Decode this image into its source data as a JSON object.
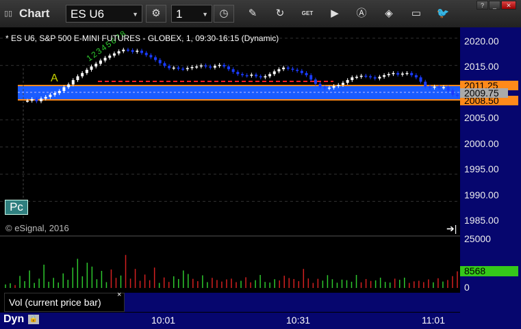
{
  "window": {
    "title": "Chart",
    "symbol": "ES U6",
    "interval": "1",
    "buttons": [
      "minimize",
      "maximize",
      "close"
    ]
  },
  "toolbar": {
    "icons": [
      "gear-icon",
      "clock-icon",
      "pencil-icon",
      "refresh-icon",
      "get-icon",
      "play-icon",
      "alert-icon",
      "tag-icon",
      "chat-icon",
      "twitter-icon"
    ],
    "get_label": "GET"
  },
  "chart": {
    "title": "* ES U6, S&P 500 E-MINI FUTURES - GLOBEX, 1, 09:30-16:15 (Dynamic)",
    "copyright": "© eSignal, 2016",
    "y_ticks": [
      "2020.00",
      "2015.00",
      "2010.00",
      "2005.00",
      "2000.00",
      "1995.00",
      "1990.00",
      "1985.00"
    ],
    "price_upper": "2011.25",
    "price_last": "2009.75",
    "price_lower": "2008.50",
    "marker_a": "A",
    "marker_pc": "Pc",
    "wave_labels": [
      "1",
      "2",
      "3",
      "4",
      "5",
      "6",
      "7",
      "8"
    ],
    "colors": {
      "up": "#ffffff",
      "down": "#1a3cff",
      "band": "#1a5cff",
      "upper_line": "#ff8a1a",
      "red_dash": "#ff2020",
      "accent_green": "#2ec92e",
      "axis_bg": "#06066e"
    }
  },
  "volume": {
    "label": "Vol (current price bar)",
    "close": "×",
    "y_ticks": [
      "25000",
      "0"
    ],
    "current": "8568",
    "colors": {
      "up": "#2ec92e",
      "down": "#d42020"
    }
  },
  "time_axis": {
    "labels": [
      "10:01",
      "10:31",
      "11:01"
    ],
    "mode": "Dyn"
  },
  "chart_data": {
    "type": "candlestick",
    "y_ylim": [
      1984,
      2022
    ],
    "prices": [
      2008.5,
      2008.8,
      2008.4,
      2008.9,
      2009.2,
      2009.6,
      2009.9,
      2010.3,
      2011.0,
      2011.5,
      2012.3,
      2013.0,
      2013.6,
      2014.2,
      2014.8,
      2015.3,
      2015.9,
      2016.4,
      2016.8,
      2017.2,
      2017.6,
      2017.9,
      2017.8,
      2017.5,
      2017.7,
      2017.3,
      2016.9,
      2016.5,
      2016.0,
      2015.4,
      2014.9,
      2014.5,
      2014.6,
      2014.4,
      2014.3,
      2014.5,
      2014.7,
      2014.8,
      2015.0,
      2014.8,
      2014.6,
      2014.9,
      2015.1,
      2014.8,
      2014.3,
      2013.8,
      2013.4,
      2013.2,
      2013.1,
      2013.3,
      2013.0,
      2012.8,
      2013.0,
      2013.4,
      2013.9,
      2014.3,
      2014.6,
      2014.4,
      2014.2,
      2014.0,
      2013.6,
      2013.2,
      2012.4,
      2011.6,
      2011.0,
      2010.8,
      2010.9,
      2011.2,
      2011.4,
      2011.8,
      2012.3,
      2012.8,
      2012.9,
      2013.1,
      2013.0,
      2012.8,
      2012.6,
      2012.9,
      2013.2,
      2013.4,
      2013.6,
      2013.3,
      2013.5,
      2013.6,
      2013.2,
      2012.8,
      2012.0,
      2011.1,
      2010.9,
      2011.1,
      2010.9,
      2011.0,
      2010.4,
      2009.6,
      2009.4
    ],
    "volumes": [
      1800,
      2400,
      1500,
      6200,
      3500,
      9000,
      2600,
      4800,
      12000,
      3200,
      5200,
      2800,
      7500,
      4200,
      10500,
      15000,
      6000,
      13000,
      11000,
      4500,
      8800,
      3000,
      9500,
      5200,
      6400,
      17000,
      4800,
      9800,
      3700,
      6900,
      4000,
      10500,
      2600,
      5400,
      3100,
      6000,
      4600,
      9000,
      7200,
      4700,
      3500,
      6500,
      3000,
      5200,
      4100,
      3300,
      4400,
      4800,
      3000,
      3700,
      5500,
      2900,
      4000,
      6700,
      3100,
      2800,
      4500,
      3900,
      6300,
      5100,
      4600,
      3500,
      9800,
      4900,
      2600,
      4700,
      3800,
      6600,
      4500,
      2700,
      4300,
      4000,
      3200,
      6700,
      2900,
      4600,
      3600,
      3900,
      5300,
      3100,
      2800,
      4800,
      4200,
      5300,
      2600,
      3400,
      3700,
      3000,
      4400,
      2900,
      5000,
      3300,
      4100,
      6100,
      8568
    ],
    "vol_ylim": [
      0,
      25000
    ]
  }
}
